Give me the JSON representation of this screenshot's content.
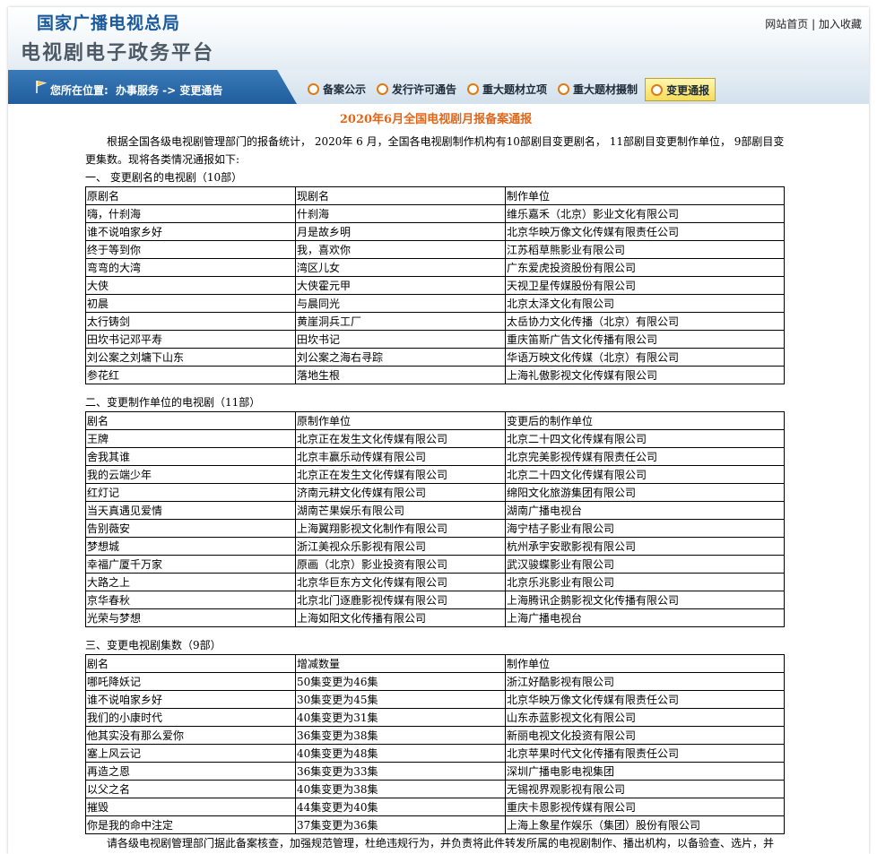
{
  "header": {
    "org": "国家广播电视总局",
    "title": "电视剧电子政务平台",
    "links": [
      "网站首页",
      "加入收藏"
    ],
    "link_separator": "|"
  },
  "nav": {
    "location_label": "您所在位置:",
    "location_path": "办事服务 -> 变更通告",
    "tabs": [
      {
        "label": "备案公示",
        "active": false
      },
      {
        "label": "发行许可通告",
        "active": false
      },
      {
        "label": "重大题材立项",
        "active": false
      },
      {
        "label": "重大题材摄制",
        "active": false
      },
      {
        "label": "变更通报",
        "active": true
      }
    ]
  },
  "notice": {
    "title": "2020年6月全国电视剧月报备案通报",
    "intro": "根据全国各级电视剧管理部门的报备统计， 2020年 6 月，全国各电视剧制作机构有10部剧目变更剧名， 11部剧目变更制作单位， 9部剧目变更集数。现将各类情况通报如下:",
    "footer": "请各级电视剧管理部门据此备案核查，加强规范管理，杜绝违规行为，并负责将此件转发所属的电视剧制作、播出机构，以备验查、选片，并"
  },
  "section1": {
    "title": "一、 变更剧名的电视剧（10部）",
    "headers": [
      "原剧名",
      "现剧名",
      "制作单位"
    ],
    "rows": [
      [
        "嗨，什刹海",
        "什刹海",
        "维乐嘉禾（北京）影业文化有限公司"
      ],
      [
        "谁不说咱家乡好",
        "月是故乡明",
        "北京华映万像文化传媒有限责任公司"
      ],
      [
        "终于等到你",
        "我，喜欢你",
        "江苏稻草熊影业有限公司"
      ],
      [
        "弯弯的大湾",
        "湾区儿女",
        "广东爱虎投资股份有限公司"
      ],
      [
        "大侠",
        "大侠霍元甲",
        "天视卫星传媒股份有限公司"
      ],
      [
        "初晨",
        "与晨同光",
        "北京太泽文化有限公司"
      ],
      [
        "太行铸剑",
        "黄崖洞兵工厂",
        "太岳协力文化传播（北京）有限公司"
      ],
      [
        "田坎书记邓平寿",
        "田坎书记",
        "重庆笛斯广告文化传播有限公司"
      ],
      [
        "刘公案之刘墉下山东",
        "刘公案之海右寻踪",
        "华语万映文化传媒（北京）有限公司"
      ],
      [
        "参花红",
        "落地生根",
        "上海礼傲影视文化传媒有限公司"
      ]
    ]
  },
  "section2": {
    "title": "二、变更制作单位的电视剧（11部）",
    "headers": [
      "剧名",
      "原制作单位",
      "变更后的制作单位"
    ],
    "rows": [
      [
        "王牌",
        "北京正在发生文化传媒有限公司",
        "北京二十四文化传媒有限公司"
      ],
      [
        "舍我其谁",
        "北京丰赢乐动传媒有限公司",
        "北京完美影视传媒有限责任公司"
      ],
      [
        "我的云端少年",
        "北京正在发生文化传媒有限公司",
        "北京二十四文化传媒有限公司"
      ],
      [
        "红灯记",
        "济南元耕文化传媒有限公司",
        "绵阳文化旅游集团有限公司"
      ],
      [
        "当天真遇见爱情",
        "湖南芒果娱乐有限公司",
        "湖南广播电视台"
      ],
      [
        "告别薇安",
        "上海翼翔影视文化制作有限公司",
        "海宁桔子影业有限公司"
      ],
      [
        "梦想城",
        "浙江美视众乐影视有限公司",
        "杭州承宇安歌影视有限公司"
      ],
      [
        "幸福广厦千万家",
        "原画（北京）影业投资有限公司",
        "武汉骏蝶影业有限公司"
      ],
      [
        "大路之上",
        "北京华巨东方文化传媒有限公司",
        "北京乐兆影业有限公司"
      ],
      [
        "京华春秋",
        "北京北门逐鹿影视传媒有限公司",
        "上海腾讯企鹅影视文化传播有限公司"
      ],
      [
        "光荣与梦想",
        "上海如阳文化传播有限公司",
        "上海广播电视台"
      ]
    ]
  },
  "section3": {
    "title": "三、变更电视剧集数（9部）",
    "headers": [
      "剧名",
      "增减数量",
      "制作单位"
    ],
    "rows": [
      [
        "哪吒降妖记",
        "50集变更为46集",
        "浙江好酷影视有限公司"
      ],
      [
        "谁不说咱家乡好",
        "30集变更为45集",
        "北京华映万像文化传媒有限责任公司"
      ],
      [
        "我们的小康时代",
        "40集变更为31集",
        "山东赤蓝影视文化有限公司"
      ],
      [
        "他其实没有那么爱你",
        "36集变更为38集",
        "新丽电视文化投资有限公司"
      ],
      [
        "塞上风云记",
        "40集变更为48集",
        "北京苹果时代文化传播有限责任公司"
      ],
      [
        "再造之恩",
        "36集变更为33集",
        "深圳广播电影电视集团"
      ],
      [
        "以父之名",
        "40集变更为38集",
        "无锡视界观影视有限公司"
      ],
      [
        "摧毁",
        "44集变更为40集",
        "重庆卡恩影视传媒有限公司"
      ],
      [
        "你是我的命中注定",
        "37集变更为36集",
        "上海上象星作娱乐（集团）股份有限公司"
      ]
    ]
  }
}
